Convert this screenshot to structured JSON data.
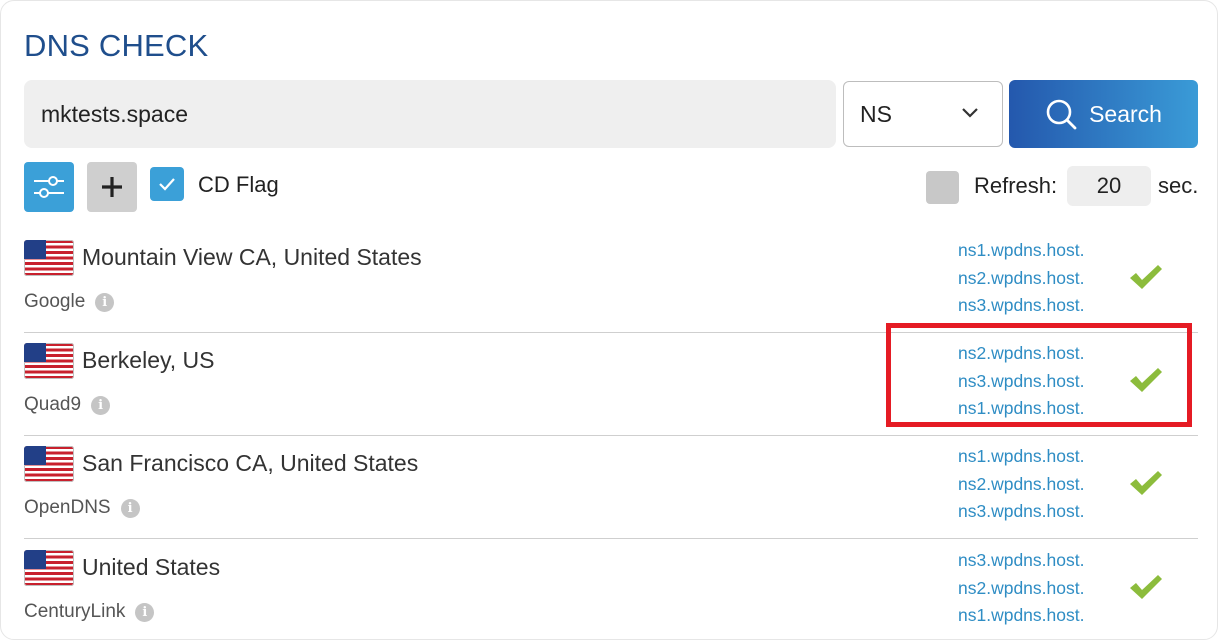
{
  "app": {
    "title": "DNS CHECK"
  },
  "search": {
    "value": "mktests.space",
    "type": "NS",
    "button_label": "Search"
  },
  "options": {
    "filter_icon": "sliders-icon",
    "add_icon": "plus-icon",
    "cd_flag_label": "CD Flag",
    "cd_flag_checked": true,
    "refresh_label": "Refresh:",
    "refresh_value": "20",
    "refresh_unit": "sec.",
    "refresh_checked": false
  },
  "results": [
    {
      "location": "Mountain View CA, United States",
      "provider": "Google",
      "flag": "us-flag",
      "records": [
        "ns1.wpdns.host.",
        "ns2.wpdns.host.",
        "ns3.wpdns.host."
      ],
      "status": "ok"
    },
    {
      "location": "Berkeley, US",
      "provider": "Quad9",
      "flag": "us-flag",
      "records": [
        "ns2.wpdns.host.",
        "ns3.wpdns.host.",
        "ns1.wpdns.host."
      ],
      "status": "ok",
      "highlighted": true
    },
    {
      "location": "San Francisco CA, United States",
      "provider": "OpenDNS",
      "flag": "us-flag",
      "records": [
        "ns1.wpdns.host.",
        "ns2.wpdns.host.",
        "ns3.wpdns.host."
      ],
      "status": "ok"
    },
    {
      "location": "United States",
      "provider": "CenturyLink",
      "flag": "us-flag",
      "records": [
        "ns3.wpdns.host.",
        "ns2.wpdns.host.",
        "ns1.wpdns.host."
      ],
      "status": "ok"
    }
  ],
  "colors": {
    "title": "#1f4e8c",
    "accent": "#3ba0d8",
    "link": "#2f8dc4",
    "ok": "#8cbc3c",
    "highlight": "#e51b24"
  }
}
